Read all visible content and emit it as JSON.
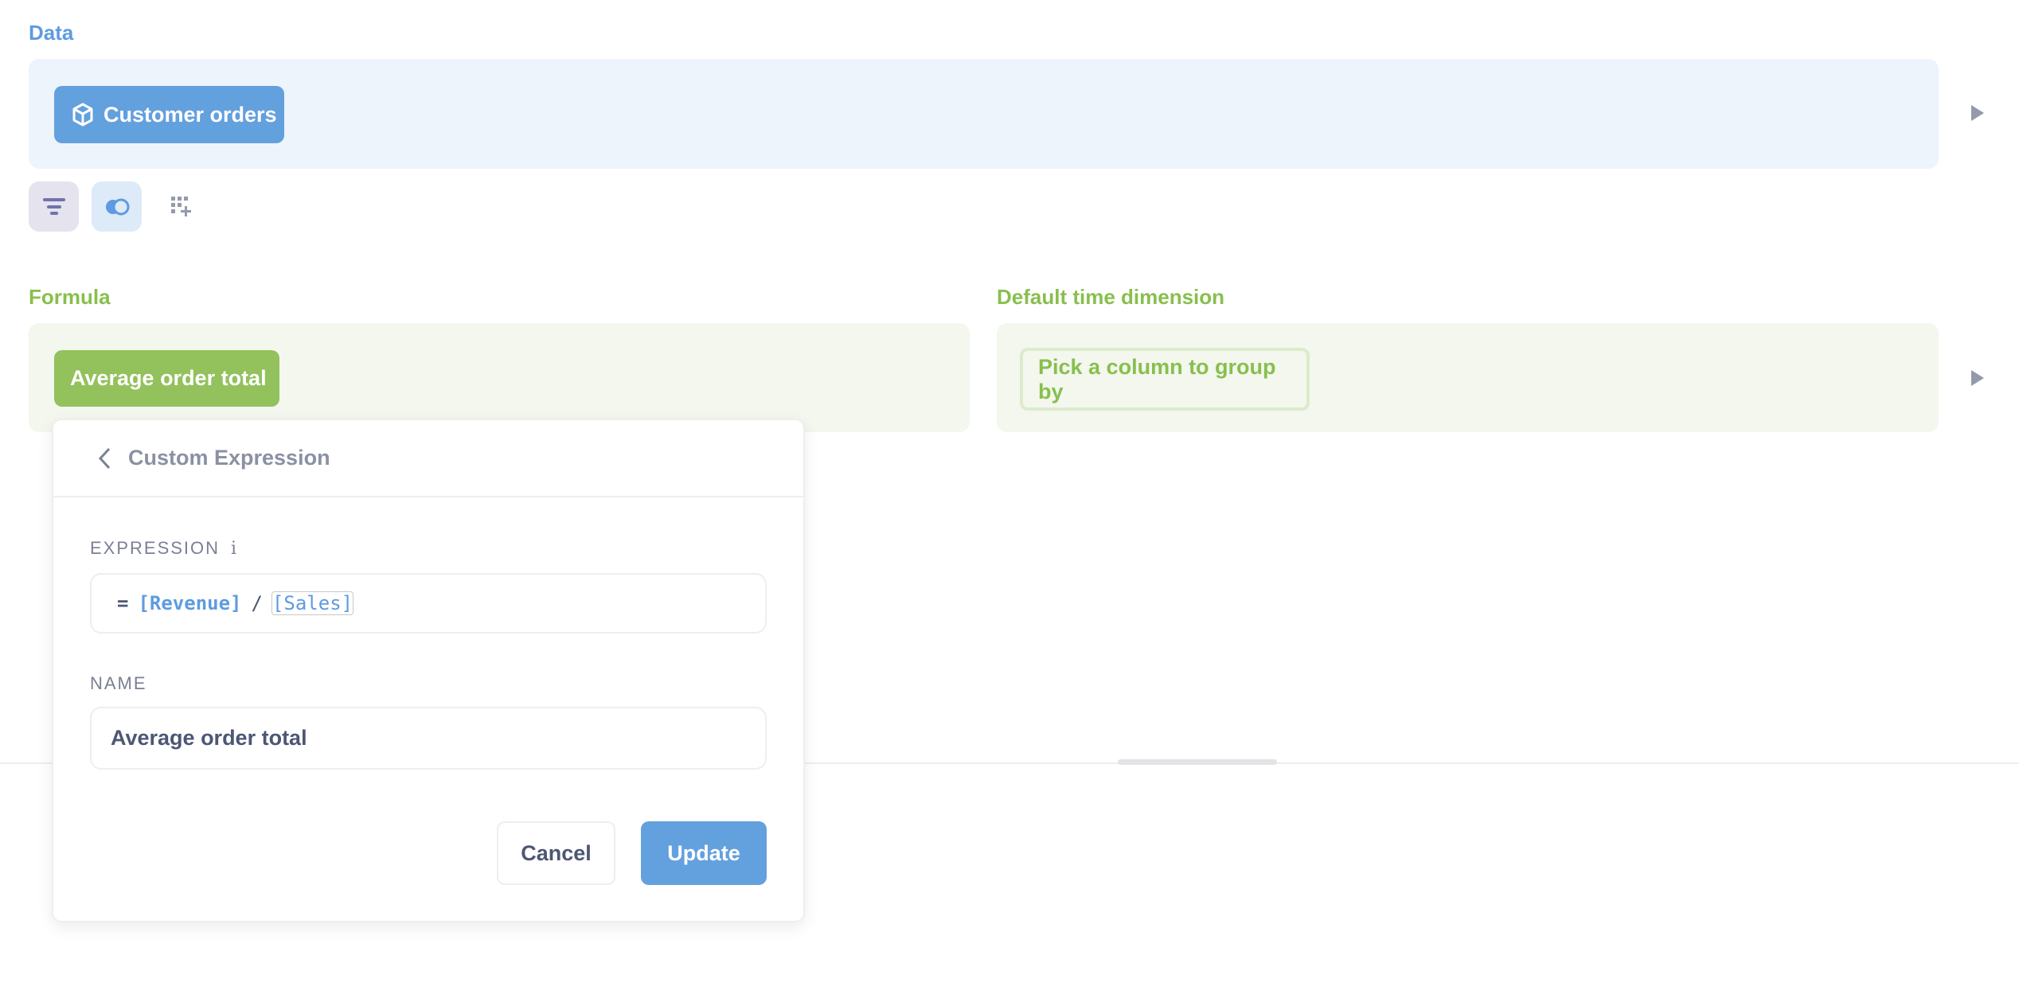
{
  "data_section": {
    "label": "Data",
    "source_button": {
      "label": "Customer orders",
      "icon": "cube-icon"
    },
    "actions": [
      {
        "name": "filter",
        "icon": "filter-icon"
      },
      {
        "name": "join",
        "icon": "join-icon"
      },
      {
        "name": "custom-column",
        "icon": "add-grid-icon"
      }
    ]
  },
  "formula_section": {
    "label": "Formula",
    "metric_button": "Average order total"
  },
  "time_dimension_section": {
    "label": "Default time dimension",
    "placeholder_button": "Pick a column to group by"
  },
  "popover": {
    "title": "Custom Expression",
    "expression_label": "EXPRESSION",
    "expression": {
      "equals": "=",
      "token1": "[Revenue]",
      "operator": "/",
      "token2": "[Sales]"
    },
    "name_label": "NAME",
    "name_value": "Average order total",
    "cancel_label": "Cancel",
    "update_label": "Update"
  },
  "colors": {
    "data_accent": "#5e9be0",
    "formula_accent": "#88bf4d",
    "filter_accent": "#7172ad"
  }
}
